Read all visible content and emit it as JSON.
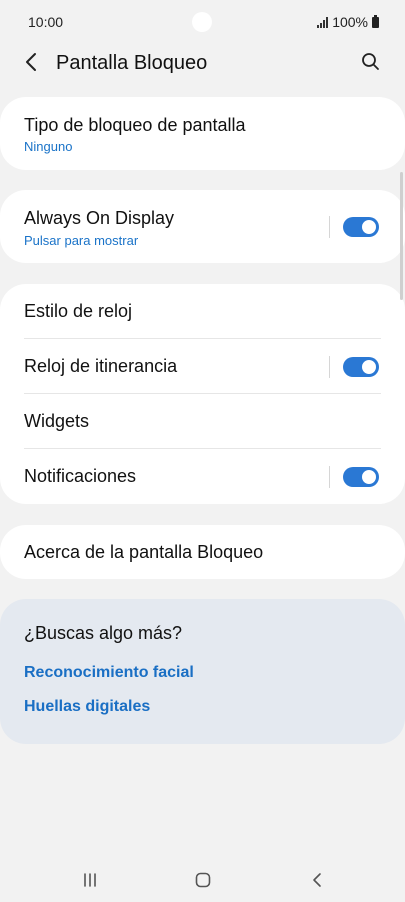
{
  "status": {
    "time": "10:00",
    "battery": "100%"
  },
  "header": {
    "title": "Pantalla Bloqueo"
  },
  "lock_type": {
    "label": "Tipo de bloqueo de pantalla",
    "value": "Ninguno"
  },
  "aod": {
    "label": "Always On Display",
    "subtitle": "Pulsar para mostrar",
    "enabled": true
  },
  "settings": {
    "clock_style": "Estilo de reloj",
    "roaming_clock": "Reloj de itinerancia",
    "widgets": "Widgets",
    "notifications": "Notificaciones"
  },
  "about": {
    "label": "Acerca de la pantalla Bloqueo"
  },
  "suggestions": {
    "title": "¿Buscas algo más?",
    "links": [
      "Reconocimiento facial",
      "Huellas digitales"
    ]
  },
  "colors": {
    "accent": "#2a78d4",
    "link": "#1a6fc4",
    "background": "#f2f2f2"
  }
}
